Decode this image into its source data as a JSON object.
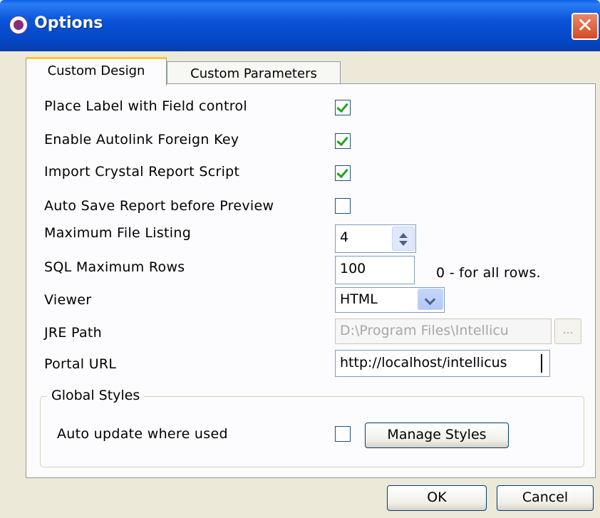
{
  "window": {
    "title": "Options",
    "close_glyph": "✕"
  },
  "tabs": [
    {
      "label": "Custom Design",
      "active": true
    },
    {
      "label": "Custom Parameters",
      "active": false
    }
  ],
  "options": {
    "place_label": {
      "label": "Place Label with Field control",
      "checked": true
    },
    "autolink": {
      "label": "Enable Autolink Foreign Key",
      "checked": true
    },
    "crystal": {
      "label": "Import Crystal Report Script",
      "checked": true
    },
    "auto_save": {
      "label": "Auto Save Report before Preview",
      "checked": false
    },
    "max_file_listing": {
      "label": "Maximum File Listing",
      "value": "4"
    },
    "sql_max_rows": {
      "label": "SQL Maximum Rows",
      "value": "100",
      "hint": "0 - for all rows."
    },
    "viewer": {
      "label": "Viewer",
      "value": "HTML"
    },
    "jre_path": {
      "label": "JRE Path",
      "value": "D:\\Program Files\\Intellicu",
      "browse_label": "..."
    },
    "portal_url": {
      "label": "Portal URL",
      "value": "http://localhost/intellicus"
    }
  },
  "global_styles": {
    "title": "Global Styles",
    "auto_update": {
      "label": "Auto update where used",
      "checked": false
    },
    "manage_label": "Manage Styles"
  },
  "buttons": {
    "ok": "OK",
    "cancel": "Cancel"
  },
  "colors": {
    "title_bar": "#0a53d8",
    "close_button": "#d64a24",
    "check_mark": "#21a121",
    "active_tab_accent": "#ffc83c",
    "dialog_bg": "#ece9d8"
  },
  "icons": {
    "app": "intellicus-app-icon",
    "close": "close-icon",
    "check": "checkmark-icon",
    "spinner_up": "spinner-up-icon",
    "spinner_down": "spinner-down-icon",
    "dropdown": "chevron-down-icon"
  }
}
